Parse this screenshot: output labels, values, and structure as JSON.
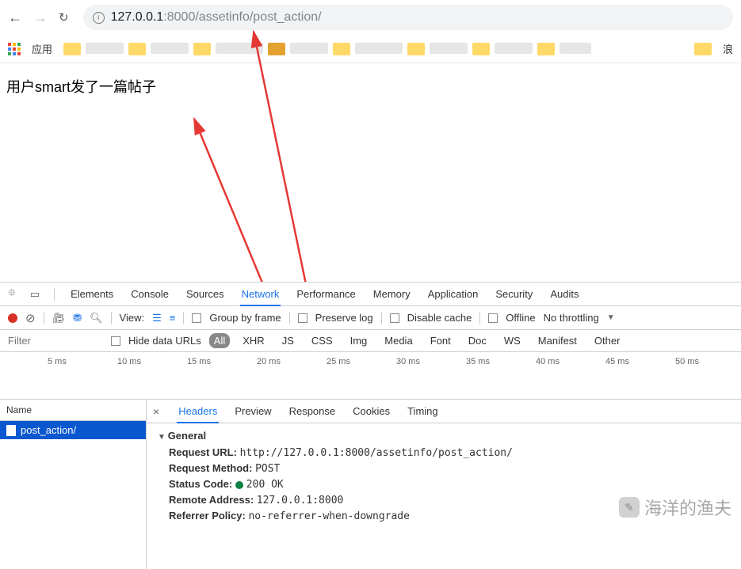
{
  "browser": {
    "url_host": "127.0.0.1",
    "url_port": ":8000",
    "url_path": "/assetinfo/post_action/",
    "apps_label": "应用",
    "last_bookmark": "浪"
  },
  "page": {
    "body_text": "用户smart发了一篇帖子"
  },
  "devtools": {
    "tabs": [
      "Elements",
      "Console",
      "Sources",
      "Network",
      "Performance",
      "Memory",
      "Application",
      "Security",
      "Audits"
    ],
    "active_tab": "Network",
    "toolbar": {
      "view_label": "View:",
      "group_by_frame": "Group by frame",
      "preserve_log": "Preserve log",
      "disable_cache": "Disable cache",
      "offline": "Offline",
      "throttling": "No throttling"
    },
    "filter": {
      "placeholder": "Filter",
      "hide_data_urls": "Hide data URLs",
      "types": [
        "All",
        "XHR",
        "JS",
        "CSS",
        "Img",
        "Media",
        "Font",
        "Doc",
        "WS",
        "Manifest",
        "Other"
      ],
      "active_type": "All"
    },
    "timeline": {
      "ticks": [
        "5 ms",
        "10 ms",
        "15 ms",
        "20 ms",
        "25 ms",
        "30 ms",
        "35 ms",
        "40 ms",
        "45 ms",
        "50 ms"
      ]
    },
    "list": {
      "header": "Name",
      "rows": [
        "post_action/"
      ]
    },
    "detail": {
      "tabs": [
        "Headers",
        "Preview",
        "Response",
        "Cookies",
        "Timing"
      ],
      "active_tab": "Headers",
      "general": {
        "title": "General",
        "request_url_label": "Request URL:",
        "request_url": "http://127.0.0.1:8000/assetinfo/post_action/",
        "request_method_label": "Request Method:",
        "request_method": "POST",
        "status_code_label": "Status Code:",
        "status_code": "200 OK",
        "remote_address_label": "Remote Address:",
        "remote_address": "127.0.0.1:8000",
        "referrer_policy_label": "Referrer Policy:",
        "referrer_policy": "no-referrer-when-downgrade"
      }
    }
  },
  "watermark": {
    "text": "海洋的渔夫"
  }
}
